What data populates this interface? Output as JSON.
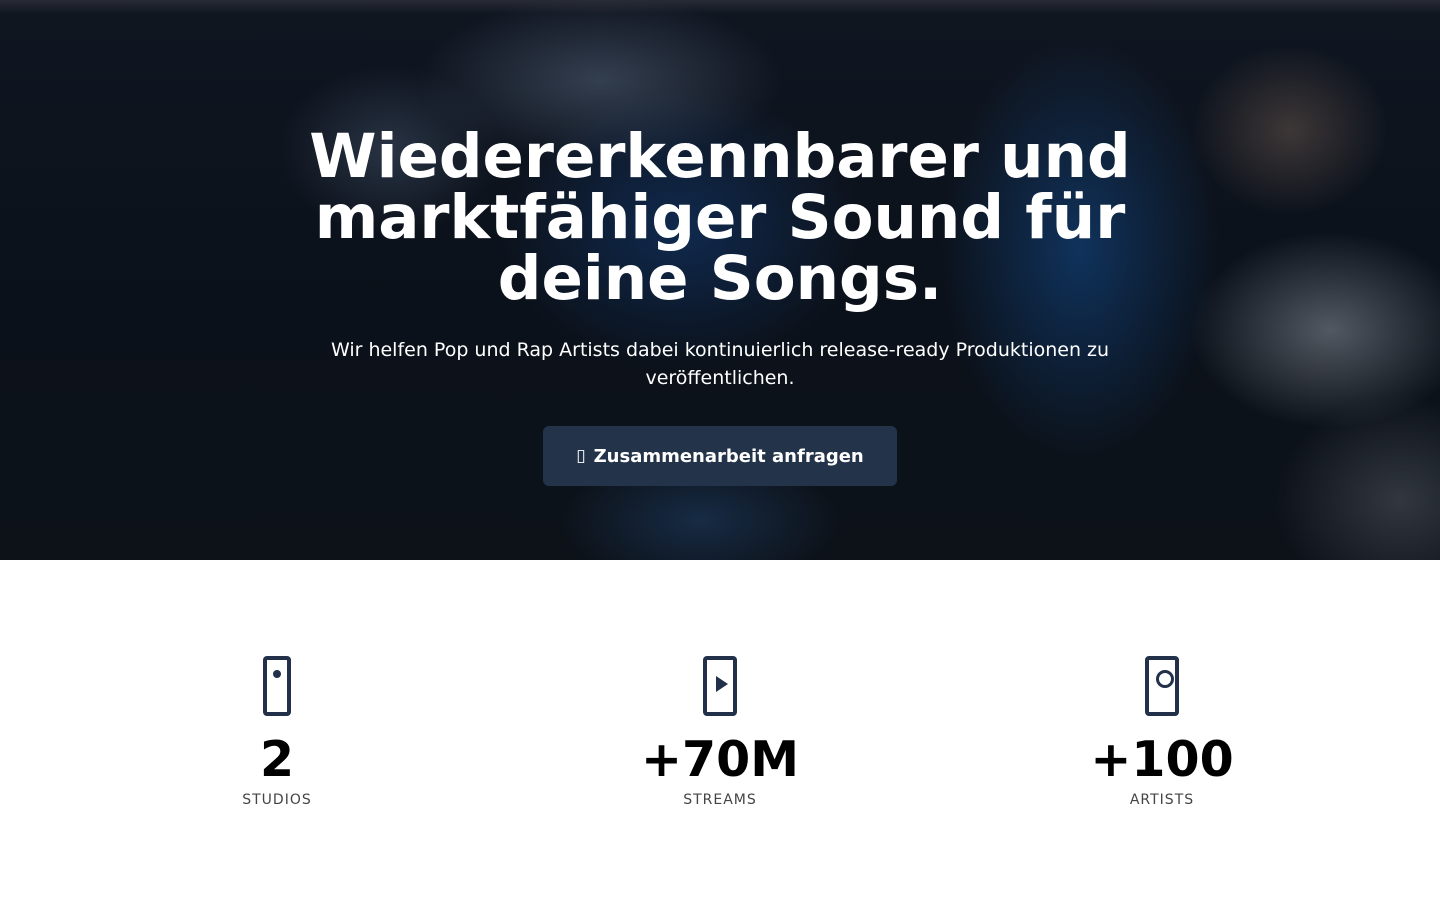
{
  "hero": {
    "title": "Wiedererkennbarer und marktfähiger Sound für deine Songs.",
    "subtitle": "Wir helfen Pop und Rap Artists dabei kontinuierlich release-ready Produktionen zu veröffentlichen.",
    "cta": {
      "icon": "calendar-icon",
      "label": "Zusammenarbeit anfragen",
      "background": "#23334a"
    }
  },
  "stats": [
    {
      "icon": "studio-icon",
      "value": "2",
      "label": "STUDIOS"
    },
    {
      "icon": "streams-icon",
      "value": "+70M",
      "label": "STREAMS"
    },
    {
      "icon": "artists-icon",
      "value": "+100",
      "label": "ARTISTS"
    }
  ],
  "colors": {
    "icon": "#22304a",
    "hero_text": "#ffffff",
    "stat_value": "#000000",
    "stat_label": "#444444"
  }
}
